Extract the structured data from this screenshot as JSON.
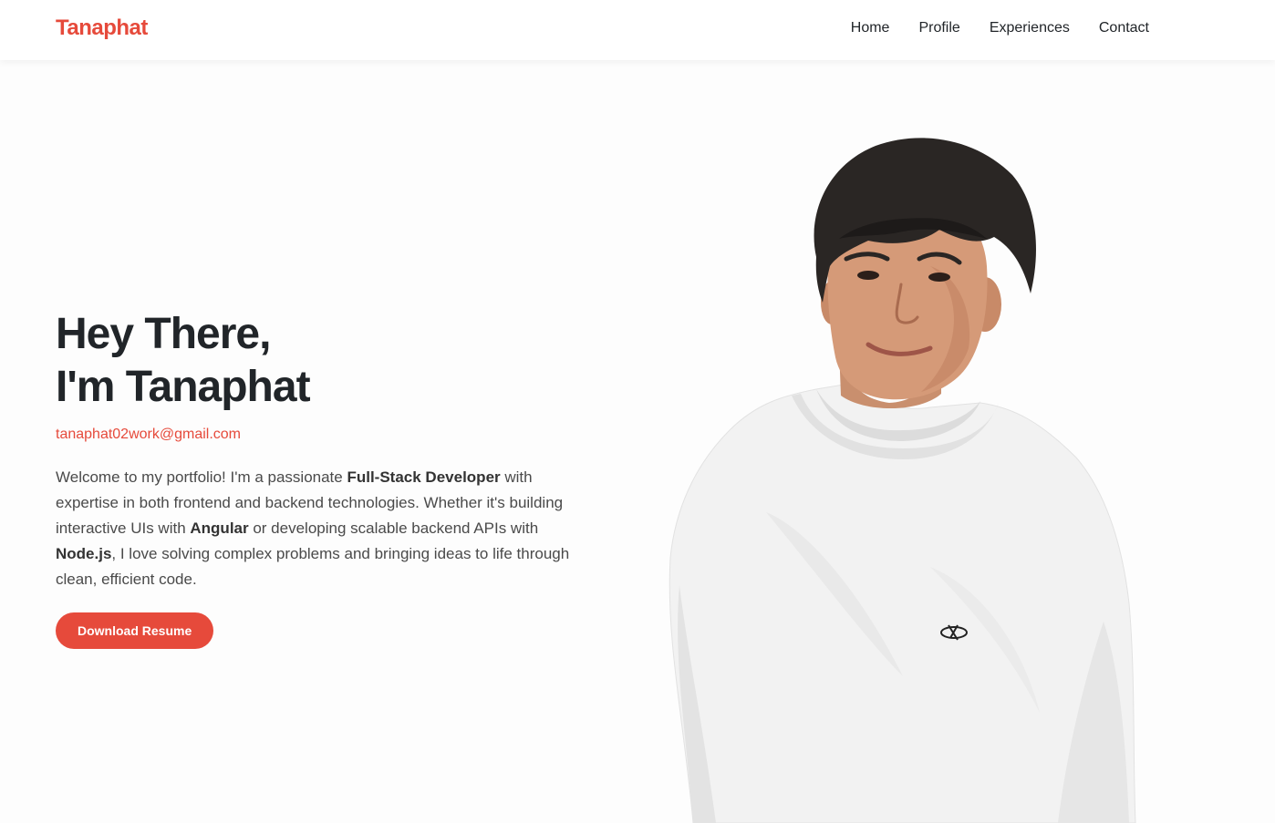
{
  "nav": {
    "brand": "Tanaphat",
    "links": [
      "Home",
      "Profile",
      "Experiences",
      "Contact"
    ]
  },
  "hero": {
    "title_line1": "Hey There,",
    "title_line2": "I'm Tanaphat",
    "email": "tanaphat02work@gmail.com",
    "desc_parts": [
      "Welcome to my portfolio! I'm a passionate ",
      "Full-Stack Developer",
      " with expertise in both frontend and backend technologies. Whether it's building interactive UIs with ",
      "Angular",
      " or developing scalable backend APIs with ",
      "Node.js",
      ", I love solving complex problems and bringing ideas to life through clean, efficient code."
    ],
    "button": "Download Resume"
  },
  "colors": {
    "accent": "#e64a3b",
    "text": "#212529",
    "body_text": "#4a4a4a"
  }
}
